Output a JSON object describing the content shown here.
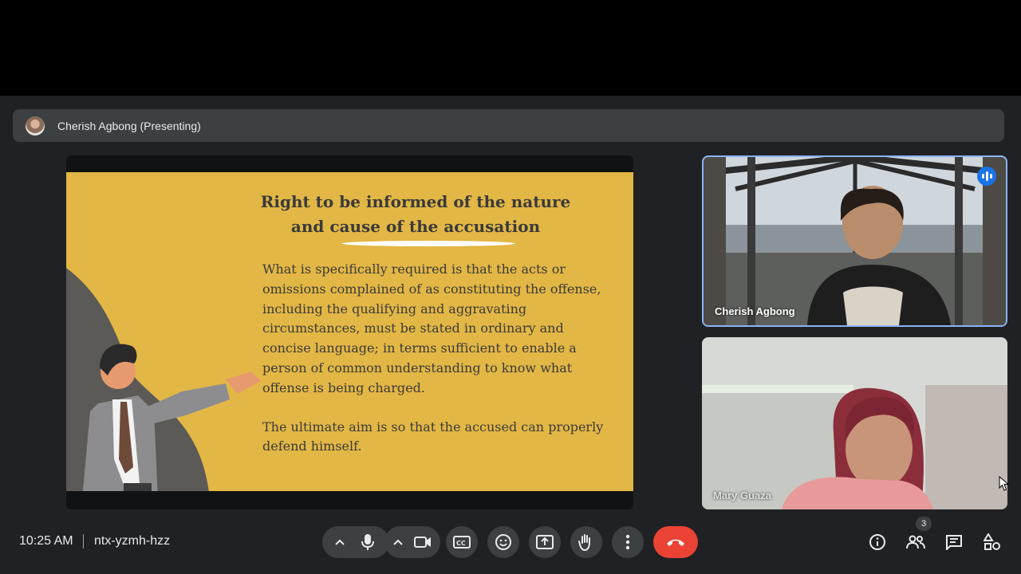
{
  "presenter": {
    "label": "Cherish Agbong (Presenting)"
  },
  "slide": {
    "title_line1": "Right to be informed of the nature",
    "title_line2": "and cause of the accusation",
    "paragraph1": "What is specifically required is that the acts or omissions complained of as constituting the offense, including the qualifying and aggravating circumstances, must be stated in ordinary and concise language; in terms sufficient to enable a person of common understanding to know what offense is being charged.",
    "paragraph2": "The ultimate aim is so that the accused can properly defend himself.",
    "background_color": "#e3b745"
  },
  "participants": [
    {
      "name": "Cherish Agbong",
      "speaking": true
    },
    {
      "name": "Mary Guaza",
      "speaking": false
    }
  ],
  "footer": {
    "time": "10:25 AM",
    "meeting_code": "ntx-yzmh-hzz",
    "people_count": "3"
  },
  "icons": [
    "mic-icon",
    "camera-icon",
    "captions-icon",
    "emoji-icon",
    "present-icon",
    "raise-hand-icon",
    "more-options-icon",
    "end-call-icon",
    "info-icon",
    "people-icon",
    "chat-icon",
    "activities-icon"
  ],
  "colors": {
    "end_call": "#ea4335",
    "active_speaker_border": "#8ab4f8",
    "toolbar_button": "#3c4043"
  }
}
